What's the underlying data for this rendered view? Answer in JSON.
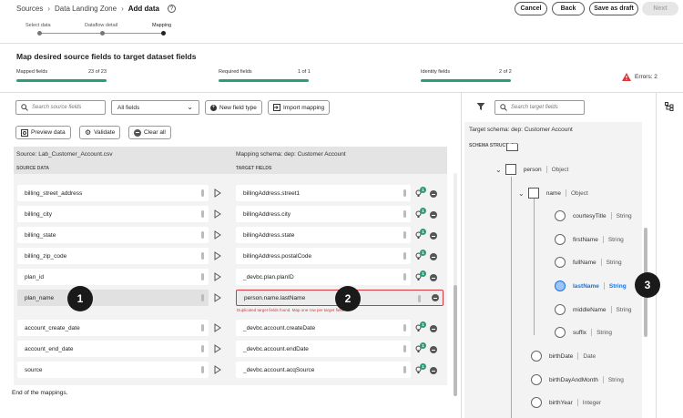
{
  "breadcrumb": [
    "Sources",
    "Data Landing Zone",
    "Add data"
  ],
  "header_buttons": {
    "cancel": "Cancel",
    "back": "Back",
    "save_draft": "Save as draft",
    "next": "Next"
  },
  "steps": [
    "Select data",
    "Dataflow detail",
    "Mapping"
  ],
  "page_title": "Map desired source fields to target dataset fields",
  "progress": [
    {
      "label": "Mapped fields",
      "value": "23 of 23",
      "fraction": 1.0
    },
    {
      "label": "Required fields",
      "value": "1 of 1",
      "fraction": 1.0
    },
    {
      "label": "Identity fields",
      "value": "2 of 2",
      "fraction": 1.0
    }
  ],
  "errors": "Errors:  2",
  "toolbar": {
    "search_placeholder": "Search source fields",
    "filter_select": "All fields",
    "new_field_type": "New field type",
    "import_mapping": "Import mapping",
    "preview_data": "Preview data",
    "validate": "Validate",
    "clear_all": "Clear all"
  },
  "source_title": "Source: Lab_Customer_Account.csv",
  "mapping_title": "Mapping schema: dep: Customer Account",
  "source_header": "SOURCE DATA",
  "target_header": "TARGET FIELDS",
  "rows": [
    {
      "source": "billing_street_address",
      "target": "billingAddress.street1",
      "count": "1"
    },
    {
      "source": "billing_city",
      "target": "billingAddress.city",
      "count": "1"
    },
    {
      "source": "billing_state",
      "target": "billingAddress.state",
      "count": "1"
    },
    {
      "source": "billing_zip_code",
      "target": "billingAddress.postalCode",
      "count": "1"
    },
    {
      "source": "plan_id",
      "target": "_devbc.plan.planID",
      "count": "1"
    },
    {
      "source": "plan_name",
      "target": "person.name.lastName",
      "count": ""
    },
    {
      "source": "account_create_date",
      "target": "_devbc.account.createDate",
      "count": "1"
    },
    {
      "source": "account_end_date",
      "target": "_devbc.account.endDate",
      "count": "1"
    },
    {
      "source": "source",
      "target": "_devbc.account.acqSource",
      "count": "1"
    }
  ],
  "error_message": "Duplicated target fields found. Map one row per target field.",
  "end_text": "End of the mappings.",
  "right_panel": {
    "search_placeholder": "Search target fields",
    "schema_title": "Target schema: dep: Customer Account",
    "structure_header": "SCHEMA STRUCTURE",
    "tree": [
      {
        "name": "person",
        "type": "Object"
      },
      {
        "name": "name",
        "type": "Object"
      },
      {
        "name": "courtesyTitle",
        "type": "String"
      },
      {
        "name": "firstName",
        "type": "String"
      },
      {
        "name": "fullName",
        "type": "String"
      },
      {
        "name": "lastName",
        "type": "String"
      },
      {
        "name": "middleName",
        "type": "String"
      },
      {
        "name": "suffix",
        "type": "String"
      },
      {
        "name": "birthDate",
        "type": "Date"
      },
      {
        "name": "birthDayAndMonth",
        "type": "String"
      },
      {
        "name": "birthYear",
        "type": "Integer"
      }
    ]
  },
  "callouts": [
    "1",
    "2",
    "3"
  ],
  "colors": {
    "accent_green": "#2d9d78",
    "selected_blue": "#1473e6",
    "error_red": "#d7373f"
  }
}
